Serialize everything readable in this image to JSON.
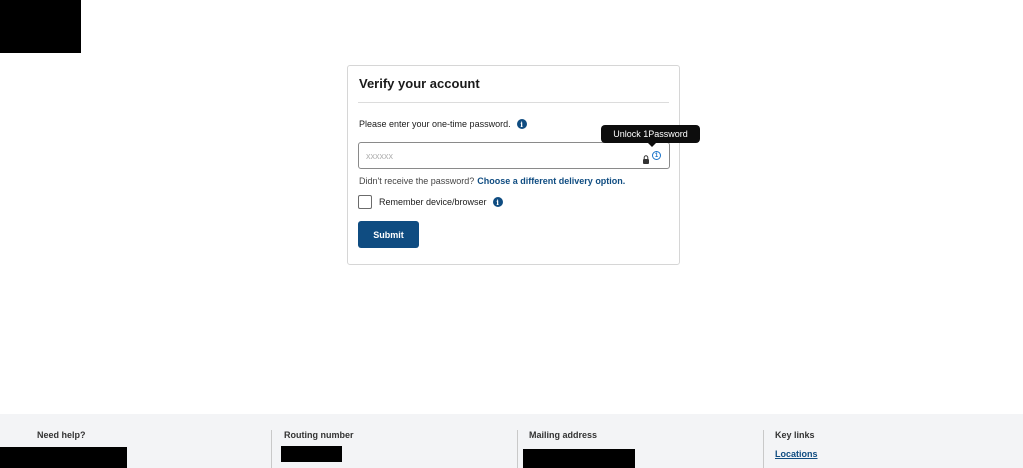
{
  "card": {
    "title": "Verify your account",
    "prompt": "Please enter your one-time password.",
    "otp_placeholder": "xxxxxx",
    "otp_value": "",
    "resend_text": "Didn't receive the password?",
    "resend_link": "Choose a different delivery option.",
    "remember_label": "Remember device/browser",
    "remember_checked": false,
    "submit_label": "Submit"
  },
  "tooltip": {
    "text": "Unlock 1Password"
  },
  "password_manager": {
    "icon_text": "1"
  },
  "footer": {
    "need_help": "Need help?",
    "routing_number": "Routing number",
    "mailing_address": "Mailing address",
    "key_links": "Key links",
    "key_links_items": [
      "Locations"
    ]
  },
  "colors": {
    "accent": "#0f4c81",
    "footer_bg": "#f3f4f6",
    "tooltip_bg": "#0d0d0d"
  },
  "icons": {
    "info": "info-circle-icon",
    "lock": "lock-icon",
    "password_manager": "1password-icon"
  }
}
